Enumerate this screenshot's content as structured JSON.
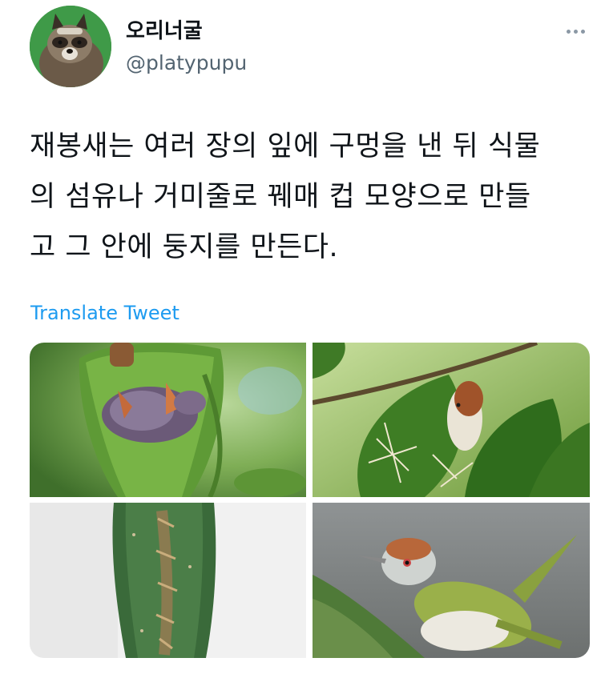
{
  "tweet": {
    "author": {
      "display_name": "오리너굴",
      "handle": "@platypupu",
      "avatar_icon": "raccoon-dog-avatar"
    },
    "more_icon": "more-options-icon",
    "text_lines": [
      "재봉새는 여러 장의 잎에 구멍을 낸 뒤 식물",
      "의 섬유나 거미줄로 꿰매 컵 모양으로 만들",
      "고 그 안에 둥지를 만든다."
    ],
    "translate_label": "Translate Tweet",
    "media": [
      {
        "icon": "tailorbird-chicks-in-leaf-nest-photo"
      },
      {
        "icon": "tailorbird-sewing-leaf-photo"
      },
      {
        "icon": "stitched-leaf-nest-photo"
      },
      {
        "icon": "tailorbird-perched-photo"
      }
    ]
  },
  "colors": {
    "text": "#0f1419",
    "secondary": "#536471",
    "link": "#1d9bf0",
    "background": "#ffffff"
  }
}
